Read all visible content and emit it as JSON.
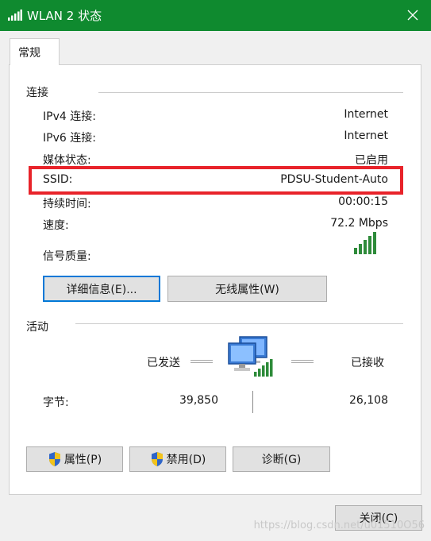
{
  "window": {
    "title": "WLAN 2 状态",
    "accent": "#0f8a2f"
  },
  "tabs": [
    {
      "label": "常规"
    }
  ],
  "connection": {
    "section_label": "连接",
    "rows": [
      {
        "label": "IPv4 连接:",
        "value": "Internet"
      },
      {
        "label": "IPv6 连接:",
        "value": "Internet"
      },
      {
        "label": "媒体状态:",
        "value": "已启用"
      },
      {
        "label": "SSID:",
        "value": "PDSU-Student-Auto"
      },
      {
        "label": "持续时间:",
        "value": "00:00:15"
      },
      {
        "label": "速度:",
        "value": "72.2 Mbps"
      }
    ],
    "signal_label": "信号质量:",
    "signal_icon": "signal-bars-icon",
    "details_button": "详细信息(E)...",
    "wireless_props_button": "无线属性(W)"
  },
  "activity": {
    "section_label": "活动",
    "sent_label": "已发送",
    "received_label": "已接收",
    "bytes_label": "字节:",
    "bytes_sent": "39,850",
    "bytes_received": "26,108",
    "icon": "network-computers-icon"
  },
  "buttons": {
    "properties": "属性(P)",
    "disable": "禁用(D)",
    "diagnose": "诊断(G)",
    "close": "关闭(C)"
  },
  "watermark": "https://blog.csdn.net/u01510O56",
  "highlight_color": "#e8232a"
}
